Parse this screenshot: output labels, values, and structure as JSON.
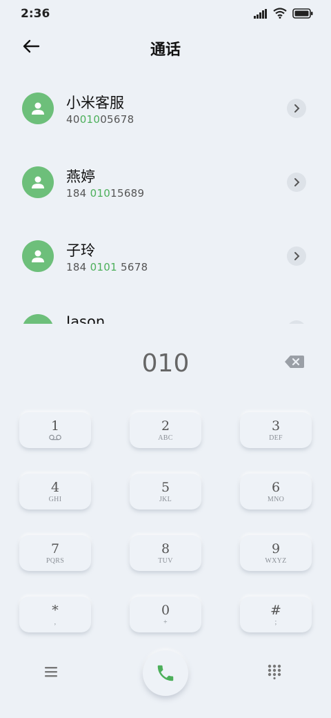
{
  "status": {
    "time": "2:36",
    "icons": [
      "signal-icon",
      "wifi-icon",
      "battery-icon"
    ]
  },
  "header": {
    "title": "通话",
    "back_icon": "back-arrow-icon"
  },
  "contacts": [
    {
      "name": "小米客服",
      "number_pre": "40",
      "number_match": "010",
      "number_post": "05678"
    },
    {
      "name": "燕婷",
      "number_pre": "184 ",
      "number_match": "010",
      "number_post": "15689"
    },
    {
      "name": "子玲",
      "number_pre": "184 ",
      "number_match": "0101",
      "number_post": " 5678"
    },
    {
      "name": "Jason",
      "number_pre": "",
      "number_match": "",
      "number_post": ""
    }
  ],
  "dial": {
    "digits": "010"
  },
  "keypad": [
    {
      "digit": "1",
      "letters": "QO"
    },
    {
      "digit": "2",
      "letters": "ABC"
    },
    {
      "digit": "3",
      "letters": "DEF"
    },
    {
      "digit": "4",
      "letters": "GHI"
    },
    {
      "digit": "5",
      "letters": "JKL"
    },
    {
      "digit": "6",
      "letters": "MNO"
    },
    {
      "digit": "7",
      "letters": "PQRS"
    },
    {
      "digit": "8",
      "letters": "TUV"
    },
    {
      "digit": "9",
      "letters": "WXYZ"
    },
    {
      "digit": "*",
      "letters": ","
    },
    {
      "digit": "0",
      "letters": "+"
    },
    {
      "digit": "#",
      "letters": ";"
    }
  ],
  "colors": {
    "background": "#edf1f6",
    "avatar": "#6dbf7a",
    "highlight": "#4caf5a",
    "call_icon": "#4caf5a"
  }
}
